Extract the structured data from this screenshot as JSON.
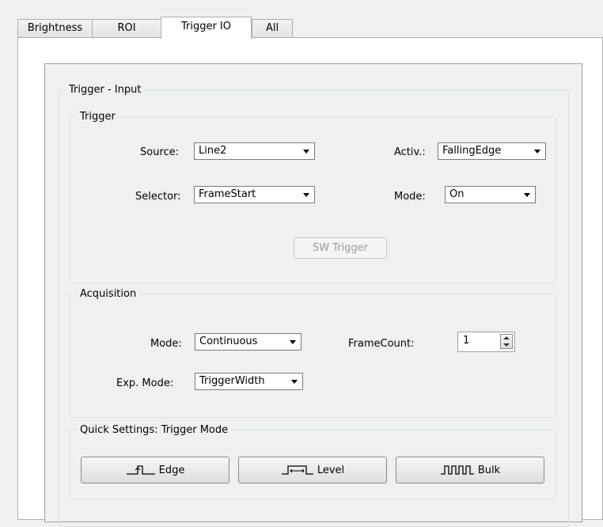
{
  "tabs": [
    {
      "label": "Brightness",
      "active": false
    },
    {
      "label": "ROI",
      "active": false
    },
    {
      "label": "Trigger IO",
      "active": true
    },
    {
      "label": "All",
      "active": false
    }
  ],
  "trigger_input": {
    "title": "Trigger - Input",
    "trigger": {
      "title": "Trigger",
      "source_label": "Source:",
      "source_value": "Line2",
      "activation_label": "Activ.:",
      "activation_value": "FallingEdge",
      "selector_label": "Selector:",
      "selector_value": "FrameStart",
      "mode_label": "Mode:",
      "mode_value": "On",
      "sw_trigger_label": "SW Trigger"
    },
    "acquisition": {
      "title": "Acquisition",
      "mode_label": "Mode:",
      "mode_value": "Continuous",
      "framecount_label": "FrameCount:",
      "framecount_value": "1",
      "exp_mode_label": "Exp. Mode:",
      "exp_mode_value": "TriggerWidth"
    },
    "quick_settings": {
      "title": "Quick Settings: Trigger Mode",
      "edge_label": "Edge",
      "level_label": "Level",
      "bulk_label": "Bulk"
    }
  }
}
